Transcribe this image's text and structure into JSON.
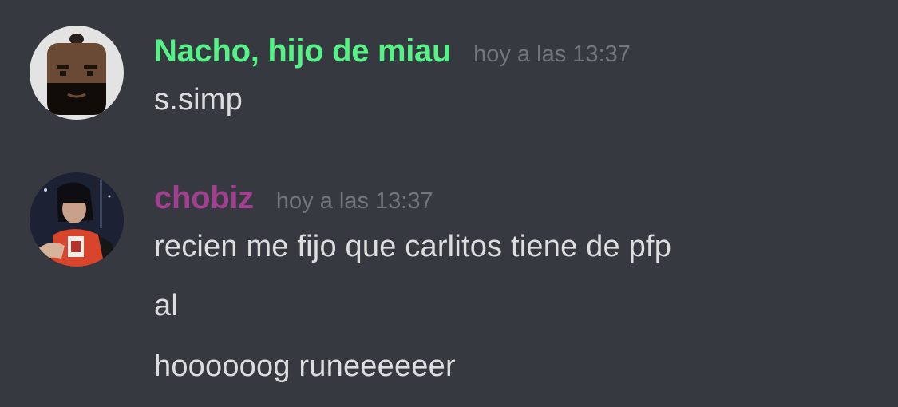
{
  "messages": [
    {
      "author": "Nacho, hijo de miau",
      "author_color": "#57f287",
      "timestamp": "hoy a las 13:37",
      "avatar_icon": "bald-man-avatar-icon",
      "lines": [
        "s.simp"
      ]
    },
    {
      "author": "chobiz",
      "author_color": "#a0408f",
      "timestamp": "hoy a las 13:37",
      "avatar_icon": "girl-photo-avatar-icon",
      "lines": [
        "recien me fijo que carlitos tiene de pfp",
        "al",
        "hoooooog runeeeeeer"
      ]
    }
  ],
  "colors": {
    "background": "#36393f",
    "message_text": "#dcddde",
    "timestamp": "#72767d"
  }
}
